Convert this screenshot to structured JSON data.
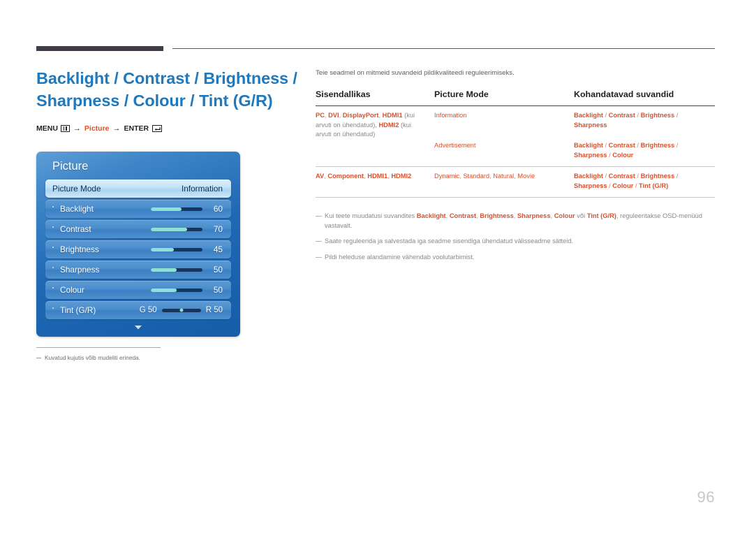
{
  "page": {
    "number": "96"
  },
  "left": {
    "title_line1": "Backlight / Contrast / Brightness /",
    "title_line2": "Sharpness / Colour / Tint (G/R)",
    "nav": {
      "menu_label": "MENU",
      "menu_icon": "menu-bars-icon",
      "arrow1": "→",
      "target": "Picture",
      "arrow2": "→",
      "enter_label": "ENTER",
      "enter_icon": "enter-return-icon"
    },
    "footnote": "Kuvatud kujutis võib mudeliti erineda."
  },
  "osd": {
    "title": "Picture",
    "chevron": "▼",
    "selected_row": {
      "label": "Picture Mode",
      "value": "Information"
    },
    "rows": [
      {
        "label": "Backlight",
        "value": "60",
        "fill_pct": 60
      },
      {
        "label": "Contrast",
        "value": "70",
        "fill_pct": 70
      },
      {
        "label": "Brightness",
        "value": "45",
        "fill_pct": 45
      },
      {
        "label": "Sharpness",
        "value": "50",
        "fill_pct": 50
      },
      {
        "label": "Colour",
        "value": "50",
        "fill_pct": 50
      }
    ],
    "tint_row": {
      "label": "Tint (G/R)",
      "left_value": "G 50",
      "right_value": "R 50"
    }
  },
  "right": {
    "intro": "Teie seadmel on mitmeid suvandeid pildikvaliteedi reguleerimiseks.",
    "table": {
      "headers": [
        "Sisendallikas",
        "Picture Mode",
        "Kohandatavad suvandid"
      ],
      "rows": [
        {
          "source_parts": [
            {
              "t": "PC",
              "s": "hl"
            },
            {
              "t": ", ",
              "s": "sep"
            },
            {
              "t": "DVI",
              "s": "hl"
            },
            {
              "t": ", ",
              "s": "sep"
            },
            {
              "t": "DisplayPort",
              "s": "hl"
            },
            {
              "t": ", ",
              "s": "sep"
            },
            {
              "t": "HDMI1",
              "s": "hl"
            },
            {
              "t": " (kui arvuti on ühendatud), ",
              "s": "plain"
            },
            {
              "t": "HDMI2",
              "s": "hl"
            },
            {
              "t": " (kui arvuti on ühendatud)",
              "s": "plain"
            }
          ],
          "mode_parts": [
            {
              "t": "Information",
              "s": "hl-n"
            }
          ],
          "options_parts": [
            {
              "t": "Backlight",
              "s": "hl"
            },
            {
              "t": " / ",
              "s": "sep"
            },
            {
              "t": "Contrast",
              "s": "hl"
            },
            {
              "t": " / ",
              "s": "sep"
            },
            {
              "t": "Brightness",
              "s": "hl"
            },
            {
              "t": " / ",
              "s": "sep"
            },
            {
              "t": "Sharpness",
              "s": "hl"
            }
          ]
        },
        {
          "source_parts": [],
          "mode_parts": [
            {
              "t": "Advertisement",
              "s": "hl-n"
            }
          ],
          "options_parts": [
            {
              "t": "Backlight",
              "s": "hl"
            },
            {
              "t": " / ",
              "s": "sep"
            },
            {
              "t": "Contrast",
              "s": "hl"
            },
            {
              "t": " / ",
              "s": "sep"
            },
            {
              "t": "Brightness",
              "s": "hl"
            },
            {
              "t": " / ",
              "s": "sep"
            },
            {
              "t": "Sharpness",
              "s": "hl"
            },
            {
              "t": " / ",
              "s": "sep"
            },
            {
              "t": "Colour",
              "s": "hl"
            }
          ]
        },
        {
          "source_parts": [
            {
              "t": "AV",
              "s": "hl"
            },
            {
              "t": ", ",
              "s": "sep"
            },
            {
              "t": "Component",
              "s": "hl"
            },
            {
              "t": ", ",
              "s": "sep"
            },
            {
              "t": "HDMI1",
              "s": "hl"
            },
            {
              "t": ", ",
              "s": "sep"
            },
            {
              "t": "HDMI2",
              "s": "hl"
            }
          ],
          "mode_parts": [
            {
              "t": "Dynamic",
              "s": "hl-n"
            },
            {
              "t": ", ",
              "s": "sep"
            },
            {
              "t": "Standard",
              "s": "hl-n"
            },
            {
              "t": ", ",
              "s": "sep"
            },
            {
              "t": "Natural",
              "s": "hl-n"
            },
            {
              "t": ", ",
              "s": "sep"
            },
            {
              "t": "Movie",
              "s": "hl-n"
            }
          ],
          "options_parts": [
            {
              "t": "Backlight",
              "s": "hl"
            },
            {
              "t": " / ",
              "s": "sep"
            },
            {
              "t": "Contrast",
              "s": "hl"
            },
            {
              "t": " / ",
              "s": "sep"
            },
            {
              "t": "Brightness",
              "s": "hl"
            },
            {
              "t": " / ",
              "s": "sep"
            },
            {
              "t": "Sharpness",
              "s": "hl"
            },
            {
              "t": " / ",
              "s": "sep"
            },
            {
              "t": "Colour",
              "s": "hl"
            },
            {
              "t": " / ",
              "s": "sep"
            },
            {
              "t": "Tint (G/R)",
              "s": "hl"
            }
          ]
        }
      ]
    },
    "notes": [
      [
        {
          "t": "Kui teete muudatusi suvandites ",
          "s": "plain"
        },
        {
          "t": "Backlight",
          "s": "hl"
        },
        {
          "t": ", ",
          "s": "sep"
        },
        {
          "t": "Contrast",
          "s": "hl"
        },
        {
          "t": ", ",
          "s": "sep"
        },
        {
          "t": "Brightness",
          "s": "hl"
        },
        {
          "t": ", ",
          "s": "sep"
        },
        {
          "t": "Sharpness",
          "s": "hl"
        },
        {
          "t": ", ",
          "s": "sep"
        },
        {
          "t": "Colour",
          "s": "hl"
        },
        {
          "t": " või ",
          "s": "plain"
        },
        {
          "t": "Tint (G/R)",
          "s": "hl"
        },
        {
          "t": ", reguleeritakse OSD-menüüd vastavalt.",
          "s": "plain"
        }
      ],
      [
        {
          "t": "Saate reguleerida ja salvestada iga seadme sisendiga ühendatud välisseadme sätteid.",
          "s": "plain"
        }
      ],
      [
        {
          "t": "Pildi heleduse alandamine vähendab voolutarbimist.",
          "s": "plain"
        }
      ]
    ]
  },
  "colors": {
    "title_blue": "#1f79be",
    "accent_orange": "#d9512c",
    "body_gray": "#8c8790",
    "rule_dark": "#443e4a",
    "osd_blue": "#1f68b4",
    "slider_fill": "#8fe0d6"
  }
}
